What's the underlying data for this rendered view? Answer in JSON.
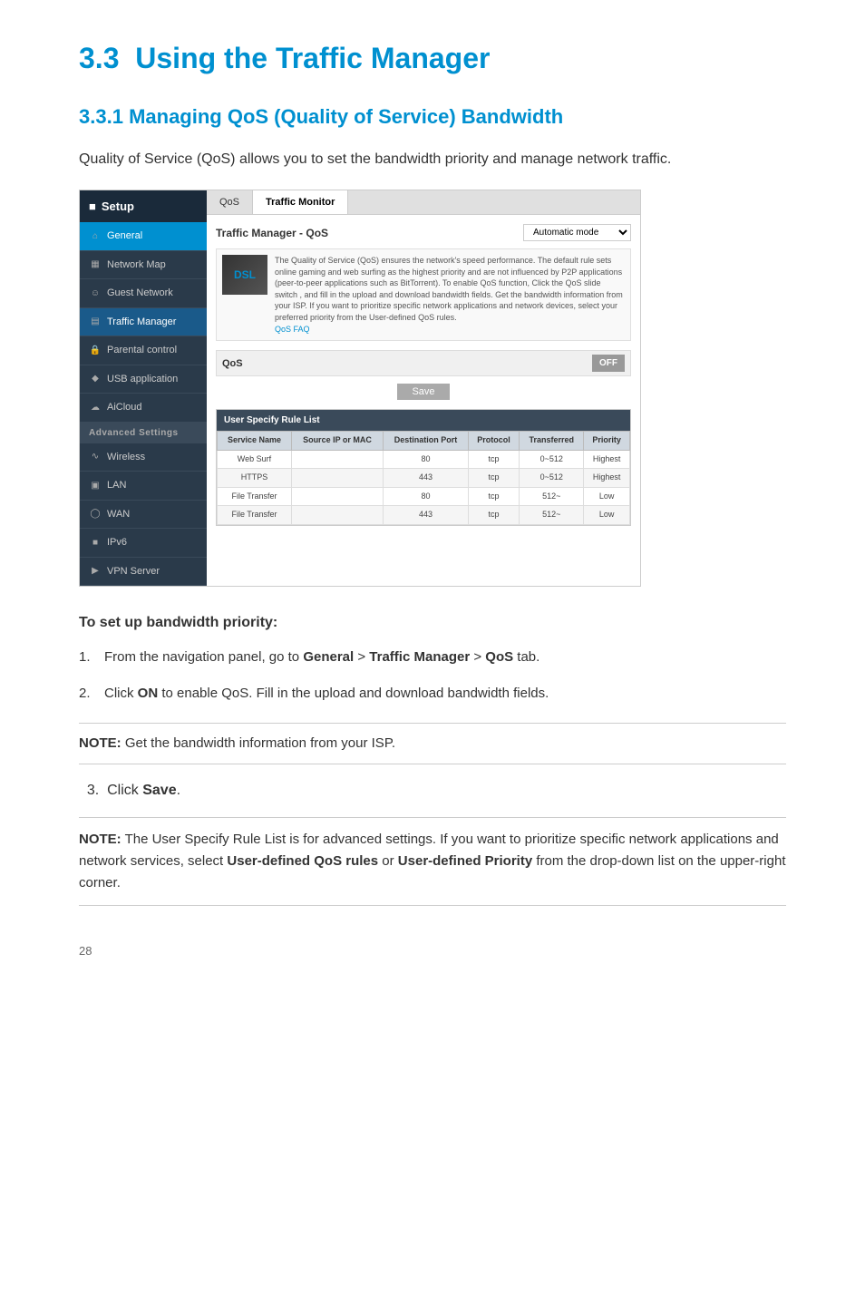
{
  "page": {
    "section_number": "3.3",
    "section_title": "Using the Traffic Manager",
    "subsection_number": "3.3.1",
    "subsection_title": "Managing QoS (Quality of Service) Bandwidth",
    "intro_text": "Quality of Service (QoS) allows you to set the bandwidth priority and manage network traffic.",
    "instruction_heading": "To set up bandwidth priority:",
    "step1_num": "1.",
    "step1_text": "From the navigation panel, go to ",
    "step1_bold1": "General",
    "step1_sep": " > ",
    "step1_bold2": "Traffic Manager",
    "step1_sep2": " > ",
    "step1_bold3": "QoS",
    "step1_end": " tab.",
    "step2_num": "2.",
    "step2_text": "Click ",
    "step2_bold": "ON",
    "step2_end": " to enable QoS. Fill in the upload and download bandwidth fields.",
    "note1_bold": "NOTE:",
    "note1_text": " Get the bandwidth information from your ISP.",
    "step3_num": "3.",
    "step3_text": "Click ",
    "step3_bold": "Save",
    "step3_end": ".",
    "note2_bold": "NOTE:",
    "note2_text": "   The User Specify Rule List is for advanced settings. If you want to prioritize specific network applications and network services, select ",
    "note2_bold2": "User-defined QoS rules",
    "note2_or": " or ",
    "note2_bold3": "User-defined Priority",
    "note2_end": " from the drop-down list on the upper-right corner.",
    "page_number": "28"
  },
  "ui": {
    "sidebar_header": "Setup",
    "tabs": [
      "QoS",
      "Traffic Monitor"
    ],
    "active_tab": "Traffic Monitor",
    "panel_title": "Traffic Manager - QoS",
    "dropdown_value": "Automatic mode",
    "info_text": "The Quality of Service (QoS) ensures the network's speed performance. The default rule sets online gaming and web surfing as the highest priority and are not influenced by P2P applications (peer-to-peer applications such as BitTorrent). To enable QoS function, Click the QoS slide switch , and fill in the upload and download bandwidth fields. Get the bandwidth information from your ISP. If you want to prioritize specific network applications and network devices, select your preferred priority from the User-defined QoS rules.",
    "qos_faq_link": "QoS FAQ",
    "qos_label": "QoS",
    "toggle_state": "OFF",
    "save_btn": "Save",
    "table_section_title": "User Specify Rule List",
    "table_headers": [
      "Service Name",
      "Source IP or MAC",
      "Destination Port",
      "Protocol",
      "Transferred",
      "Priority"
    ],
    "table_rows": [
      [
        "Web Surf",
        "",
        "80",
        "tcp",
        "0~512",
        "Highest"
      ],
      [
        "HTTPS",
        "",
        "443",
        "tcp",
        "0~512",
        "Highest"
      ],
      [
        "File Transfer",
        "",
        "80",
        "tcp",
        "512~",
        "Low"
      ],
      [
        "File Transfer",
        "",
        "443",
        "tcp",
        "512~",
        "Low"
      ]
    ],
    "sidebar_items": [
      {
        "label": "General",
        "active": true,
        "icon": "home"
      },
      {
        "label": "Network Map",
        "active": false,
        "icon": "map"
      },
      {
        "label": "Guest Network",
        "active": false,
        "icon": "users"
      },
      {
        "label": "Traffic Manager",
        "active": true,
        "highlight": true,
        "icon": "chart"
      },
      {
        "label": "Parental control",
        "active": false,
        "icon": "lock"
      },
      {
        "label": "USB application",
        "active": false,
        "icon": "usb"
      },
      {
        "label": "AiCloud",
        "active": false,
        "icon": "cloud"
      },
      {
        "label": "Advanced Settings",
        "section": true
      },
      {
        "label": "Wireless",
        "active": false,
        "icon": "wifi"
      },
      {
        "label": "LAN",
        "active": false,
        "icon": "lan"
      },
      {
        "label": "WAN",
        "active": false,
        "icon": "wan"
      },
      {
        "label": "IPv6",
        "active": false,
        "icon": "ipv6"
      },
      {
        "label": "VPN Server",
        "active": false,
        "icon": "vpn"
      }
    ],
    "logo_text": "DSL"
  }
}
